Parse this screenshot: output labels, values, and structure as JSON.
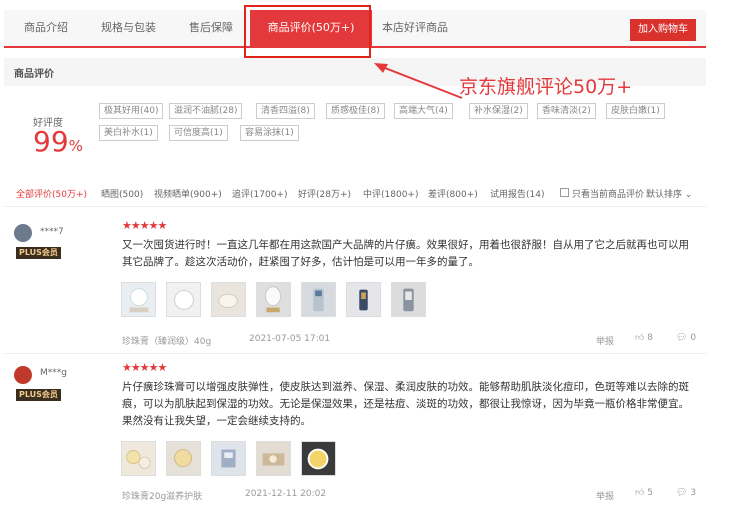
{
  "tabs": {
    "intro": "商品介绍",
    "spec": "规格与包装",
    "service": "售后保障",
    "reviews": "商品评价(50万+)",
    "store_top": "本店好评商品",
    "cart": "加入购物车"
  },
  "section": {
    "title": "商品评价"
  },
  "annotation": {
    "text": "京东旗舰评论50万+"
  },
  "rating": {
    "label": "好评度",
    "value": "99",
    "unit": "%"
  },
  "tags": [
    "极其好用(40)",
    "滋润不油腻(28)",
    "清香四溢(8)",
    "质感极佳(8)",
    "高端大气(4)",
    "补水保湿(2)",
    "香味清淡(2)",
    "皮肤白嫩(1)",
    "美白补水(1)",
    "可信度高(1)",
    "容易涂抹(1)"
  ],
  "filters": {
    "all": "全部评价(50万+)",
    "pics": "晒图(500)",
    "video": "视频晒单(900+)",
    "append": "追评(1700+)",
    "good": "好评(28万+)",
    "mid": "中评(1800+)",
    "bad": "差评(800+)",
    "trial": "试用报告(14)",
    "current_only": "只看当前商品评价",
    "sort": "默认排序"
  },
  "reviews": [
    {
      "user": "****7",
      "badge": "PLUS会员",
      "stars": "★★★★★",
      "text": "又一次囤货进行时！一直这几年都在用这款国产大品牌的片仔癀。效果很好，用着也很舒服！自从用了它之后就再也可以用其它品牌了。趁这次活动价，赶紧囤了好多，估计怕是可以用一年多的量了。",
      "spec": "珍珠膏（臻润级）40g",
      "date": "2021-07-05 17:01",
      "report": "举报",
      "likes": "8",
      "comments": "0"
    },
    {
      "user": "M***g",
      "badge": "PLUS会员",
      "stars": "★★★★★",
      "text": "片仔癀珍珠膏可以增强皮肤弹性，使皮肤达到滋养、保湿、柔润皮肤的功效。能够帮助肌肤淡化痘印，色斑等难以去除的斑痕，可以为肌肤起到保湿的功效。无论是保湿效果，还是祛痘、淡斑的功效，都很让我惊讶，因为毕竟一瓶价格非常便宜。果然没有让我失望，一定会继续支持的。",
      "spec": "珍珠膏20g滋养护肤",
      "date": "2021-12-11 20:02",
      "report": "举报",
      "likes": "5",
      "comments": "3"
    }
  ]
}
